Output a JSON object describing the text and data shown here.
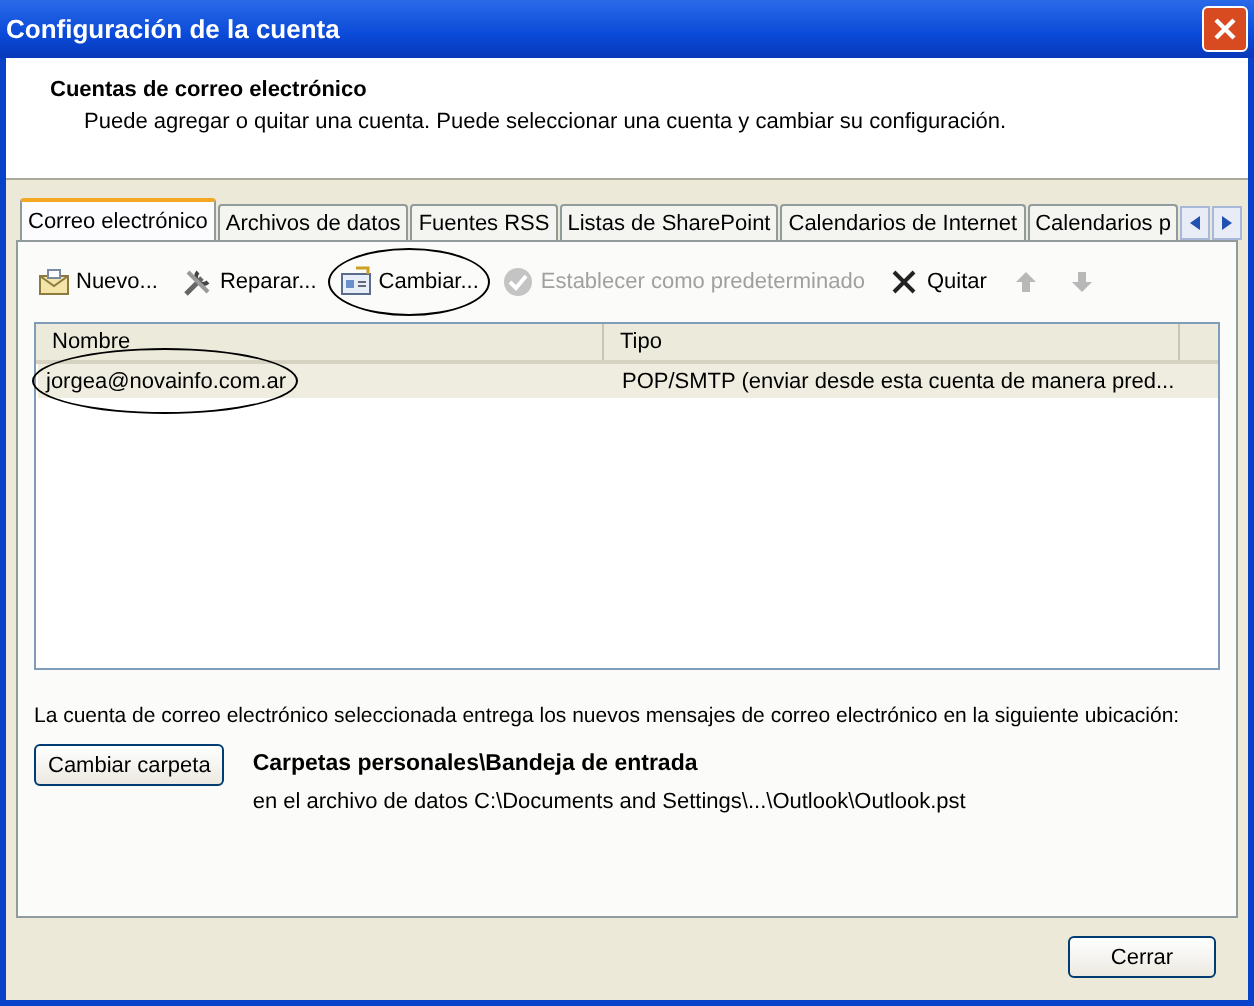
{
  "window": {
    "title": "Configuración de la cuenta"
  },
  "header": {
    "title": "Cuentas de correo electrónico",
    "subtitle": "Puede agregar o quitar una cuenta. Puede seleccionar una cuenta y cambiar su configuración."
  },
  "tabs": [
    {
      "label": "Correo electrónico",
      "selected": true
    },
    {
      "label": "Archivos de datos",
      "selected": false
    },
    {
      "label": "Fuentes RSS",
      "selected": false
    },
    {
      "label": "Listas de SharePoint",
      "selected": false
    },
    {
      "label": "Calendarios de Internet",
      "selected": false
    },
    {
      "label": "Calendarios p",
      "selected": false
    }
  ],
  "toolbar": [
    {
      "kind": "new",
      "label": "Nuevo...",
      "disabled": false,
      "circled": false
    },
    {
      "kind": "repair",
      "label": "Reparar...",
      "disabled": false,
      "circled": false
    },
    {
      "kind": "change",
      "label": "Cambiar...",
      "disabled": false,
      "circled": true
    },
    {
      "kind": "default",
      "label": "Establecer como predeterminado",
      "disabled": true,
      "circled": false
    },
    {
      "kind": "remove",
      "label": "Quitar",
      "disabled": false,
      "circled": false
    },
    {
      "kind": "up",
      "disabled": true
    },
    {
      "kind": "down",
      "disabled": true
    }
  ],
  "table": {
    "columns": [
      "Nombre",
      "Tipo"
    ],
    "rows": [
      {
        "name": "jorgea@novainfo.com.ar",
        "type": "POP/SMTP (enviar desde esta cuenta de manera pred...",
        "selected": true,
        "circled": true
      }
    ]
  },
  "delivery": {
    "text": "La cuenta de correo electrónico seleccionada entrega los nuevos mensajes de correo electrónico en la siguiente ubicación:",
    "button": "Cambiar carpeta",
    "folder": "Carpetas personales\\Bandeja de entrada",
    "file": "en el archivo de datos C:\\Documents and Settings\\...\\Outlook\\Outlook.pst"
  },
  "close_button": "Cerrar"
}
